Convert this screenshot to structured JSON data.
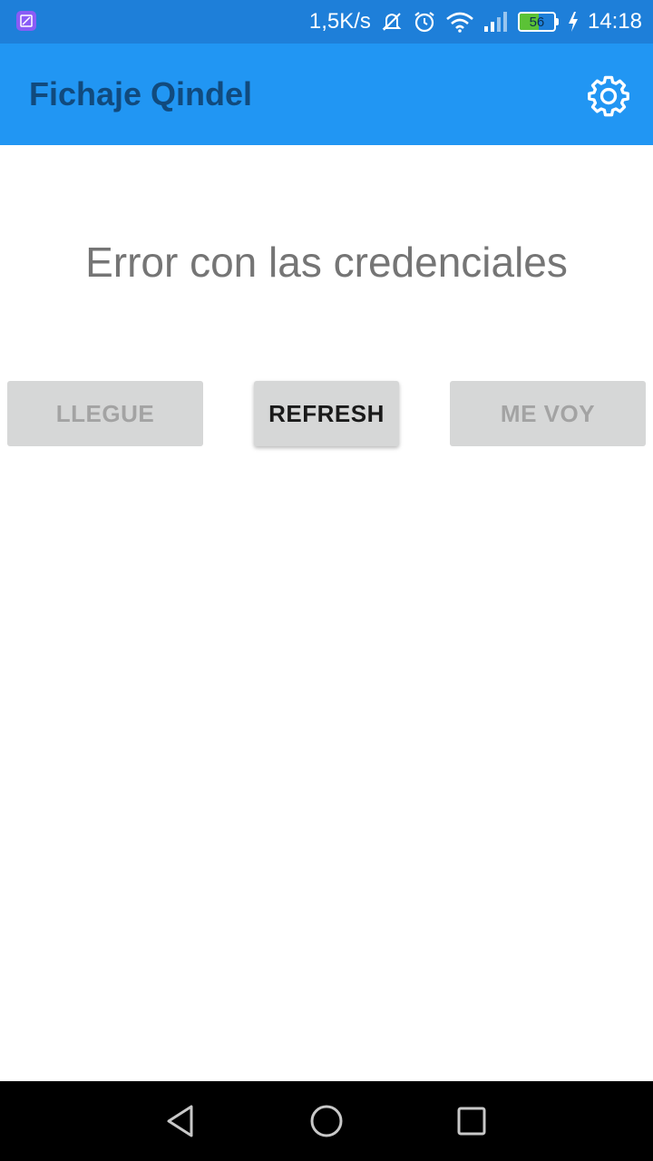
{
  "status_bar": {
    "network_speed": "1,5K/s",
    "battery_level": "56",
    "time": "14:18",
    "icons": [
      "gallery-notification-icon",
      "mute-icon",
      "alarm-icon",
      "wifi-icon",
      "signal-icon",
      "battery-icon",
      "charging-icon"
    ]
  },
  "app_bar": {
    "title": "Fichaje Qindel",
    "settings_icon": "gear-icon"
  },
  "main": {
    "message": "Error con las credenciales",
    "buttons": {
      "arrive_label": "LLEGUE",
      "refresh_label": "REFRESH",
      "leave_label": "ME VOY"
    }
  },
  "nav_bar": {
    "icons": [
      "back-icon",
      "home-icon",
      "recents-icon"
    ]
  },
  "colors": {
    "status_bar": "#1e7fd9",
    "app_bar": "#2196f3",
    "title_text": "#114a7d",
    "button_bg": "#d6d7d7",
    "disabled_text": "#a3a3a3",
    "message_text": "#757575"
  }
}
